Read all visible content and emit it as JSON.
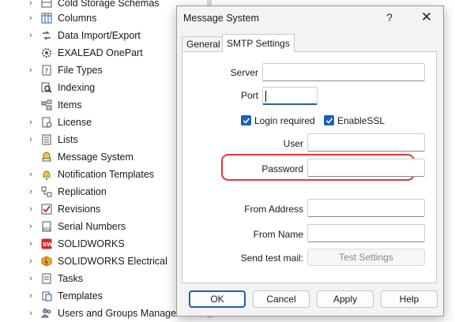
{
  "tree": {
    "items": [
      {
        "label": "Cold Storage Schemas",
        "icon": "cold-storage-icon",
        "chevron": true
      },
      {
        "label": "Columns",
        "icon": "columns-icon",
        "chevron": true
      },
      {
        "label": "Data Import/Export",
        "icon": "data-import-export-icon",
        "chevron": true
      },
      {
        "label": "EXALEAD OnePart",
        "icon": "gear-icon",
        "chevron": false
      },
      {
        "label": "File Types",
        "icon": "file-types-icon",
        "chevron": true
      },
      {
        "label": "Indexing",
        "icon": "indexing-icon",
        "chevron": false
      },
      {
        "label": "Items",
        "icon": "items-icon",
        "chevron": false
      },
      {
        "label": "License",
        "icon": "license-icon",
        "chevron": true
      },
      {
        "label": "Lists",
        "icon": "lists-icon",
        "chevron": true
      },
      {
        "label": "Message System",
        "icon": "message-system-icon",
        "chevron": false
      },
      {
        "label": "Notification Templates",
        "icon": "notification-bell-icon",
        "chevron": true
      },
      {
        "label": "Replication",
        "icon": "replication-icon",
        "chevron": true
      },
      {
        "label": "Revisions",
        "icon": "revisions-icon",
        "chevron": true
      },
      {
        "label": "Serial Numbers",
        "icon": "serial-numbers-icon",
        "chevron": true
      },
      {
        "label": "SOLIDWORKS",
        "icon": "solidworks-icon",
        "chevron": true
      },
      {
        "label": "SOLIDWORKS Electrical",
        "icon": "solidworks-electrical-icon",
        "chevron": true
      },
      {
        "label": "Tasks",
        "icon": "tasks-icon",
        "chevron": true
      },
      {
        "label": "Templates",
        "icon": "templates-icon",
        "chevron": true
      },
      {
        "label": "Users and Groups Management",
        "icon": "users-groups-icon",
        "chevron": true
      }
    ]
  },
  "dialog": {
    "title": "Message System",
    "help_label": "?",
    "close_label": "✕",
    "tabs": [
      {
        "label": "General",
        "active": false
      },
      {
        "label": "SMTP Settings",
        "active": true
      }
    ],
    "form": {
      "server_label": "Server",
      "server_value": "",
      "port_label": "Port",
      "port_value": "",
      "login_required_label": "Login required",
      "login_required_checked": true,
      "enable_ssl_label": "EnableSSL",
      "enable_ssl_checked": true,
      "user_label": "User",
      "user_value": "",
      "password_label": "Password",
      "password_value": "",
      "from_address_label": "From Address",
      "from_address_value": "",
      "from_name_label": "From Name",
      "from_name_value": "",
      "send_test_label": "Send test mail:",
      "test_settings_label": "Test Settings"
    },
    "buttons": {
      "ok": "OK",
      "cancel": "Cancel",
      "apply": "Apply",
      "help": "Help"
    }
  },
  "colors": {
    "accent": "#1e5fb3",
    "highlight_ring": "#e0393b"
  }
}
